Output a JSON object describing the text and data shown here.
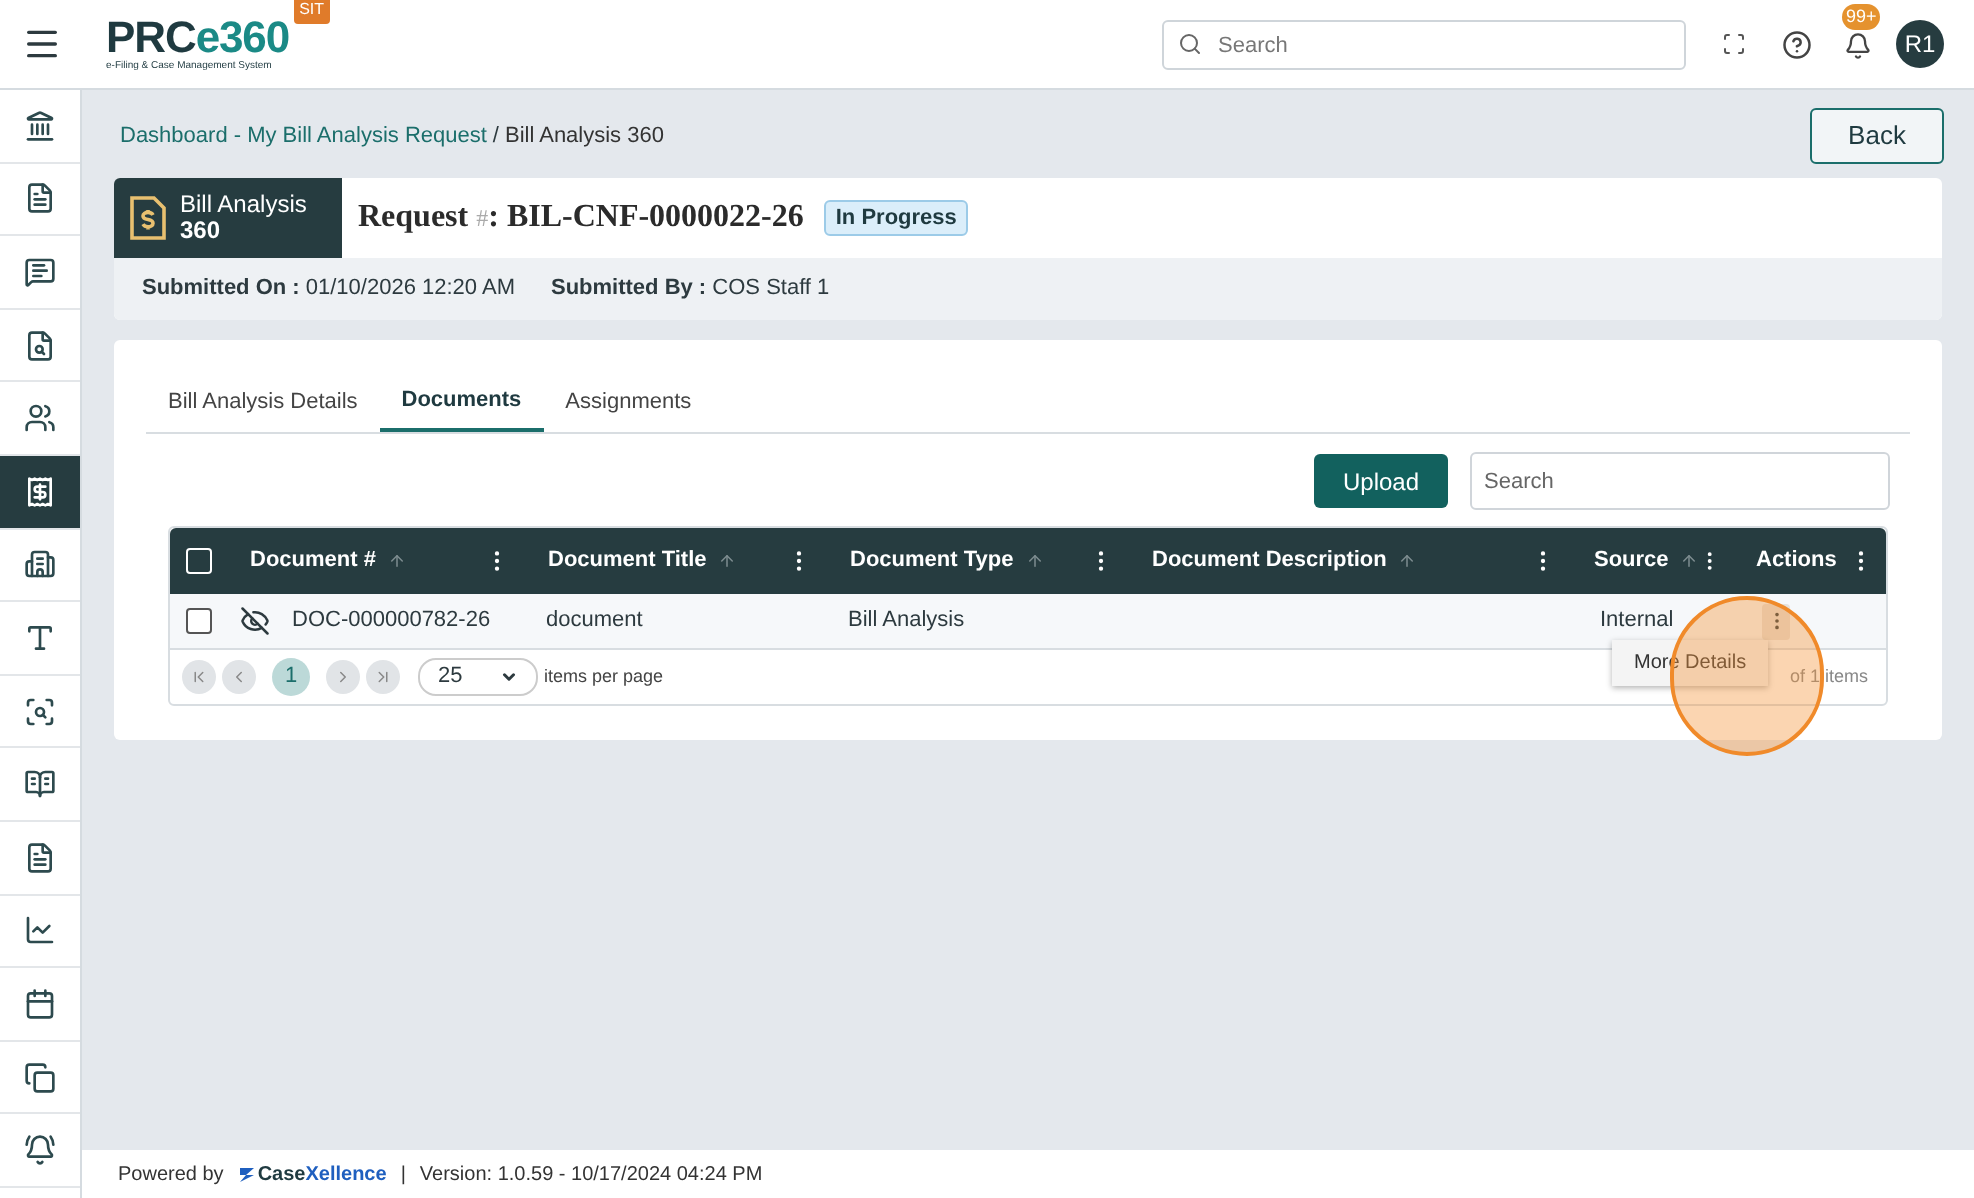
{
  "header": {
    "logo": {
      "part_1": "PRC",
      "part_2": "e360",
      "tagline": "e-Filing & Case Management System"
    },
    "env_badge": "SIT",
    "search": {
      "placeholder": "Search"
    },
    "notifications": {
      "count": "99+"
    },
    "avatar": {
      "initials": "R1"
    }
  },
  "sidebar": {
    "items": [
      {
        "selected": false
      },
      {
        "selected": false
      },
      {
        "selected": false
      },
      {
        "selected": false
      },
      {
        "selected": false
      },
      {
        "selected": true
      },
      {
        "selected": false
      },
      {
        "selected": false
      },
      {
        "selected": false
      },
      {
        "selected": false
      },
      {
        "selected": false
      },
      {
        "selected": false
      },
      {
        "selected": false
      },
      {
        "selected": false
      },
      {
        "selected": false
      }
    ]
  },
  "breadcrumb": {
    "items": [
      "Dashboard - My Bill Analysis Request",
      "Bill Analysis 360"
    ],
    "separator": "/"
  },
  "back_button": "Back",
  "request": {
    "module_title": "Bill Analysis",
    "module_subtitle": "360",
    "label": "Request",
    "label_mark": "#",
    "number": ": BIL-CNF-0000022-26",
    "status": "In Progress",
    "submitted_on_label": "Submitted On :",
    "submitted_on": "01/10/2026 12:20 AM",
    "submitted_by_label": "Submitted By :",
    "submitted_by": "COS Staff 1"
  },
  "tabs": [
    {
      "label": "Bill Analysis Details",
      "selected": false
    },
    {
      "label": "Documents",
      "selected": true
    },
    {
      "label": "Assignments",
      "selected": false
    }
  ],
  "toolbar": {
    "upload_button": "Upload",
    "search": {
      "placeholder": "Search"
    }
  },
  "table": {
    "select_all": {
      "checked": false
    },
    "columns": [
      {
        "label": "Document #",
        "sortable": true
      },
      {
        "label": "Document Title",
        "sortable": true
      },
      {
        "label": "Document Type",
        "sortable": true
      },
      {
        "label": "Document Description",
        "sortable": true
      },
      {
        "label": "Source",
        "sortable": true
      },
      {
        "label": "Actions",
        "sortable": false
      }
    ],
    "rows": [
      {
        "checked": false,
        "hidden": true,
        "document_no": "DOC-000000782-26",
        "title": "document",
        "type": "Bill Analysis",
        "source": "Internal"
      }
    ],
    "pager": {
      "page": "1",
      "page_size": "25",
      "page_size_label": "items per page",
      "info": "of 1 items"
    },
    "context_menu": {
      "items": [
        "More Details"
      ]
    }
  },
  "footer": {
    "powered_by": "Powered by",
    "brand_part_1": "Case",
    "brand_part_2": "Xellence",
    "separator": "|",
    "version": "Version: 1.0.59 - 10/17/2024 04:24 PM"
  }
}
